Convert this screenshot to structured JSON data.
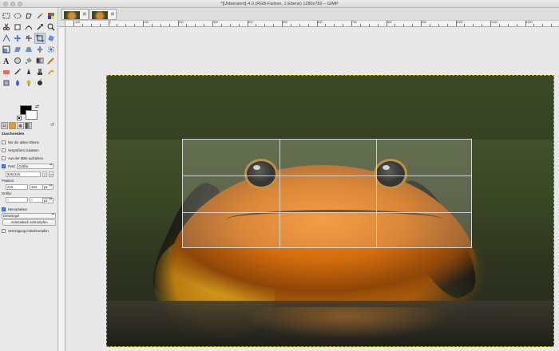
{
  "window": {
    "title": "*[Unbenannt]-4.0 (RGB-Farben, 1 Ebene) 1280x782 – GIMP"
  },
  "image_tabs": [
    {
      "name": "tab-image-1"
    },
    {
      "name": "tab-image-2"
    }
  ],
  "rulers": {
    "top_labels": [
      "-100",
      "0",
      "100",
      "200",
      "300",
      "400",
      "500",
      "600",
      "700",
      "800",
      "900",
      "1000",
      "1100",
      "1200",
      "1300"
    ]
  },
  "tool_options": {
    "title": "Zuschneiden",
    "only_active_layer": "Nur die aktive Ebene",
    "allow_growing": "Vergrößern zulassen",
    "expand_from_center": "Aus der Mitte aufziehen",
    "fixed_label": "Fest:",
    "fixed_mode": "Größe",
    "size_value": "826x315",
    "position_label": "Position:",
    "position_unit": "px",
    "position_x": "218",
    "position_y": "184",
    "size_label": "Größe:",
    "size_unit": "px",
    "size_w": "0",
    "size_h": "0",
    "highlight": "Hervorheben",
    "guides": "Drittelregel",
    "auto_shrink": "Automatisch schrumpfen",
    "merge_shrink": "Vereinigung mitschrumpfen"
  },
  "colors": {
    "foreground": "#000000",
    "background": "#ffffff",
    "accent": "#3d78d8"
  }
}
